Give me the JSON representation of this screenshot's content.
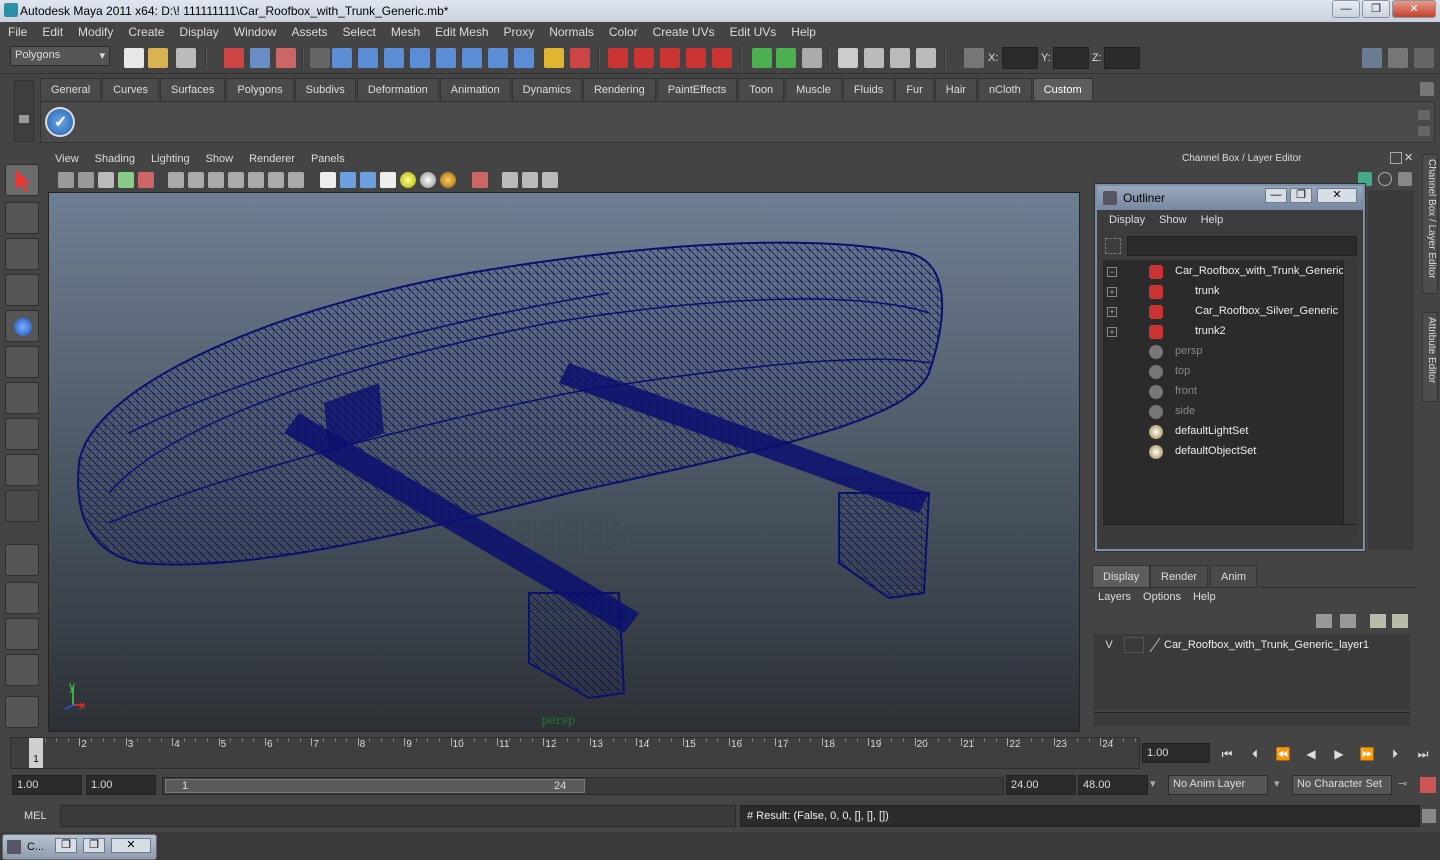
{
  "window": {
    "title": "Autodesk Maya 2011 x64: D:\\! 111111111\\Car_Roofbox_with_Trunk_Generic.mb*",
    "min_glyph": "—",
    "max_glyph": "❐",
    "close_glyph": "✕"
  },
  "menubar": [
    "File",
    "Edit",
    "Modify",
    "Create",
    "Display",
    "Window",
    "Assets",
    "Select",
    "Mesh",
    "Edit Mesh",
    "Proxy",
    "Normals",
    "Color",
    "Create UVs",
    "Edit UVs",
    "Help"
  ],
  "statusline": {
    "mode": "Polygons",
    "x_label": "X:",
    "y_label": "Y:",
    "z_label": "Z:"
  },
  "shelf_tabs": [
    "General",
    "Curves",
    "Surfaces",
    "Polygons",
    "Subdivs",
    "Deformation",
    "Animation",
    "Dynamics",
    "Rendering",
    "PaintEffects",
    "Toon",
    "Muscle",
    "Fluids",
    "Fur",
    "Hair",
    "nCloth",
    "Custom"
  ],
  "shelf_active_tab": "Custom",
  "panel": {
    "menu": [
      "View",
      "Shading",
      "Lighting",
      "Show",
      "Renderer",
      "Panels"
    ],
    "camera_label": "persp"
  },
  "channel_box": {
    "title": "Channel Box / Layer Editor"
  },
  "outliner": {
    "title": "Outliner",
    "menu": [
      "Display",
      "Show",
      "Help"
    ],
    "items": [
      {
        "label": "Car_Roofbox_with_Trunk_Generic",
        "type": "mesh",
        "expand": "−",
        "indent": 0
      },
      {
        "label": "trunk",
        "type": "mesh",
        "expand": "+",
        "indent": 1
      },
      {
        "label": "Car_Roofbox_Silver_Generic",
        "type": "mesh",
        "expand": "+",
        "indent": 1
      },
      {
        "label": "trunk2",
        "type": "mesh",
        "expand": "+",
        "indent": 1
      },
      {
        "label": "persp",
        "type": "camera",
        "expand": "",
        "indent": 0
      },
      {
        "label": "top",
        "type": "camera",
        "expand": "",
        "indent": 0
      },
      {
        "label": "front",
        "type": "camera",
        "expand": "",
        "indent": 0
      },
      {
        "label": "side",
        "type": "camera",
        "expand": "",
        "indent": 0
      },
      {
        "label": "defaultLightSet",
        "type": "set",
        "expand": "",
        "indent": 0
      },
      {
        "label": "defaultObjectSet",
        "type": "set",
        "expand": "",
        "indent": 0
      }
    ]
  },
  "side_tabs": [
    "Channel Box / Layer Editor",
    "Attribute Editor"
  ],
  "layer_editor": {
    "tabs": [
      "Display",
      "Render",
      "Anim"
    ],
    "active_tab": "Display",
    "menu": [
      "Layers",
      "Options",
      "Help"
    ],
    "layer": {
      "visible": "V",
      "name": "Car_Roofbox_with_Trunk_Generic_layer1"
    }
  },
  "timeline": {
    "frames": [
      "1",
      "2",
      "3",
      "4",
      "5",
      "6",
      "7",
      "8",
      "9",
      "10",
      "11",
      "12",
      "13",
      "14",
      "15",
      "16",
      "17",
      "18",
      "19",
      "20",
      "21",
      "22",
      "23",
      "24"
    ],
    "current_frame": "1",
    "current_time_field": "1.00"
  },
  "range": {
    "start_field": "1.00",
    "start_field2": "1.00",
    "slider_start": "1",
    "slider_end": "24",
    "end_field": "24.00",
    "end_field2": "48.00",
    "anim_layer": "No Anim Layer",
    "character_set": "No Character Set"
  },
  "command": {
    "label": "MEL",
    "result": "# Result: (False, 0, 0, [], [], [])"
  },
  "minimized_window": {
    "label": "C..."
  },
  "colors": {
    "wireframe": "#0b0f6e",
    "viewport_top": "#6f7f93",
    "viewport_bottom": "#2d3136",
    "axis_y": "#3ed43e",
    "axis_x": "#e03030",
    "axis_z": "#3050ff"
  },
  "axis": {
    "y": "y",
    "x": "x"
  }
}
